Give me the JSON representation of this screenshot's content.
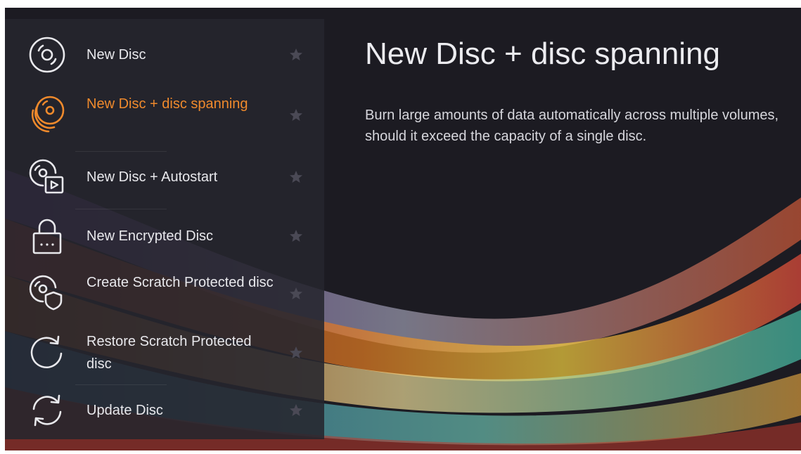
{
  "menu": {
    "items": [
      {
        "label": "New Disc",
        "icon": "disc-icon"
      },
      {
        "label": "New Disc + disc spanning",
        "icon": "disc-stack-icon",
        "active": true
      },
      {
        "label": "New Disc + Autostart",
        "icon": "disc-autostart-icon"
      },
      {
        "label": "New Encrypted Disc",
        "icon": "lock-icon"
      },
      {
        "label": "Create Scratch Protected disc",
        "icon": "disc-shield-icon"
      },
      {
        "label": "Restore Scratch Protected disc",
        "icon": "restore-icon"
      },
      {
        "label": "Update Disc",
        "icon": "refresh-icon"
      }
    ]
  },
  "detail": {
    "title": "New Disc + disc spanning",
    "description": "Burn large amounts of data automatically across multiple volumes, should it exceed the capacity of a single disc."
  },
  "colors": {
    "accent": "#f08a2c",
    "background": "#1c1b22",
    "text": "#e8e8ec",
    "star": "#4a4955"
  }
}
